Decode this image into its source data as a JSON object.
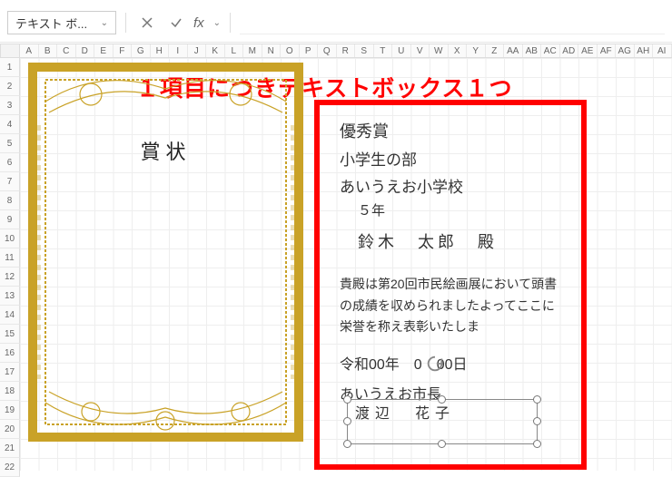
{
  "toolbar": {
    "name_box": "テキスト ボ...",
    "fx_label": "fx",
    "formula": ""
  },
  "columns": [
    "A",
    "B",
    "C",
    "D",
    "E",
    "F",
    "G",
    "H",
    "I",
    "J",
    "K",
    "L",
    "M",
    "N",
    "O",
    "P",
    "Q",
    "R",
    "S",
    "T",
    "U",
    "V",
    "W",
    "X",
    "Y",
    "Z",
    "AA",
    "AB",
    "AC",
    "AD",
    "AE",
    "AF",
    "AG",
    "AH",
    "AI"
  ],
  "rows": [
    "1",
    "2",
    "3",
    "4",
    "5",
    "6",
    "7",
    "8",
    "9",
    "10",
    "11",
    "12",
    "13",
    "14",
    "15",
    "16",
    "17",
    "18",
    "19",
    "20",
    "21",
    "22"
  ],
  "certificate": {
    "title": "賞状"
  },
  "annotation": {
    "heading": "１項目につきテキストボックス１つ",
    "prize": "優秀賞",
    "division": "小学生の部",
    "school": "あいうえお小学校",
    "grade": "５年",
    "name": "鈴木　太郎　殿",
    "body": "貴殿は第20回市民絵画展において頭書の成績を収められましたよってここに栄誉を称え表彰いたしま",
    "date": "令和00年　0　00日",
    "mayor": "あいうえお市長",
    "signer": "渡辺　花子"
  }
}
